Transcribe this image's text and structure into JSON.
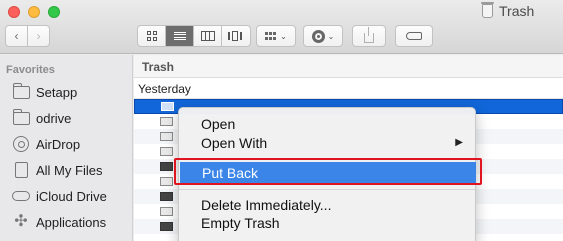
{
  "window": {
    "title": "Trash",
    "colors": {
      "close": "#fc605b",
      "minimize": "#fdbc40",
      "zoom": "#34c84a"
    }
  },
  "toolbar": {
    "back_icon": "chevron-left-icon",
    "forward_icon": "chevron-right-icon",
    "view_modes": [
      "icon-view",
      "list-view",
      "column-view",
      "cover-flow-view"
    ],
    "active_view": "list-view",
    "arrange_icon": "arrange-icon",
    "action_icon": "gear-icon",
    "share_icon": "share-icon",
    "tag_icon": "tag-icon",
    "back_glyph": "‹",
    "forward_glyph": "›",
    "caret_glyph": "⌄"
  },
  "sidebar": {
    "heading": "Favorites",
    "items": [
      {
        "label": "Setapp",
        "icon": "folder-icon"
      },
      {
        "label": "odrive",
        "icon": "folder-icon"
      },
      {
        "label": "AirDrop",
        "icon": "airdrop-icon"
      },
      {
        "label": "All My Files",
        "icon": "all-files-icon"
      },
      {
        "label": "iCloud Drive",
        "icon": "cloud-icon"
      },
      {
        "label": "Applications",
        "icon": "applications-icon"
      }
    ]
  },
  "main": {
    "header": "Trash",
    "group": "Yesterday"
  },
  "context_menu": {
    "items": [
      "Open",
      "Open With",
      "Put Back",
      "Delete Immediately...",
      "Empty Trash"
    ],
    "highlighted": "Put Back",
    "submenu_glyph": "▶",
    "accent": "#3b85e8",
    "annotation_color": "#e0141e"
  },
  "apps_glyph": "✣"
}
